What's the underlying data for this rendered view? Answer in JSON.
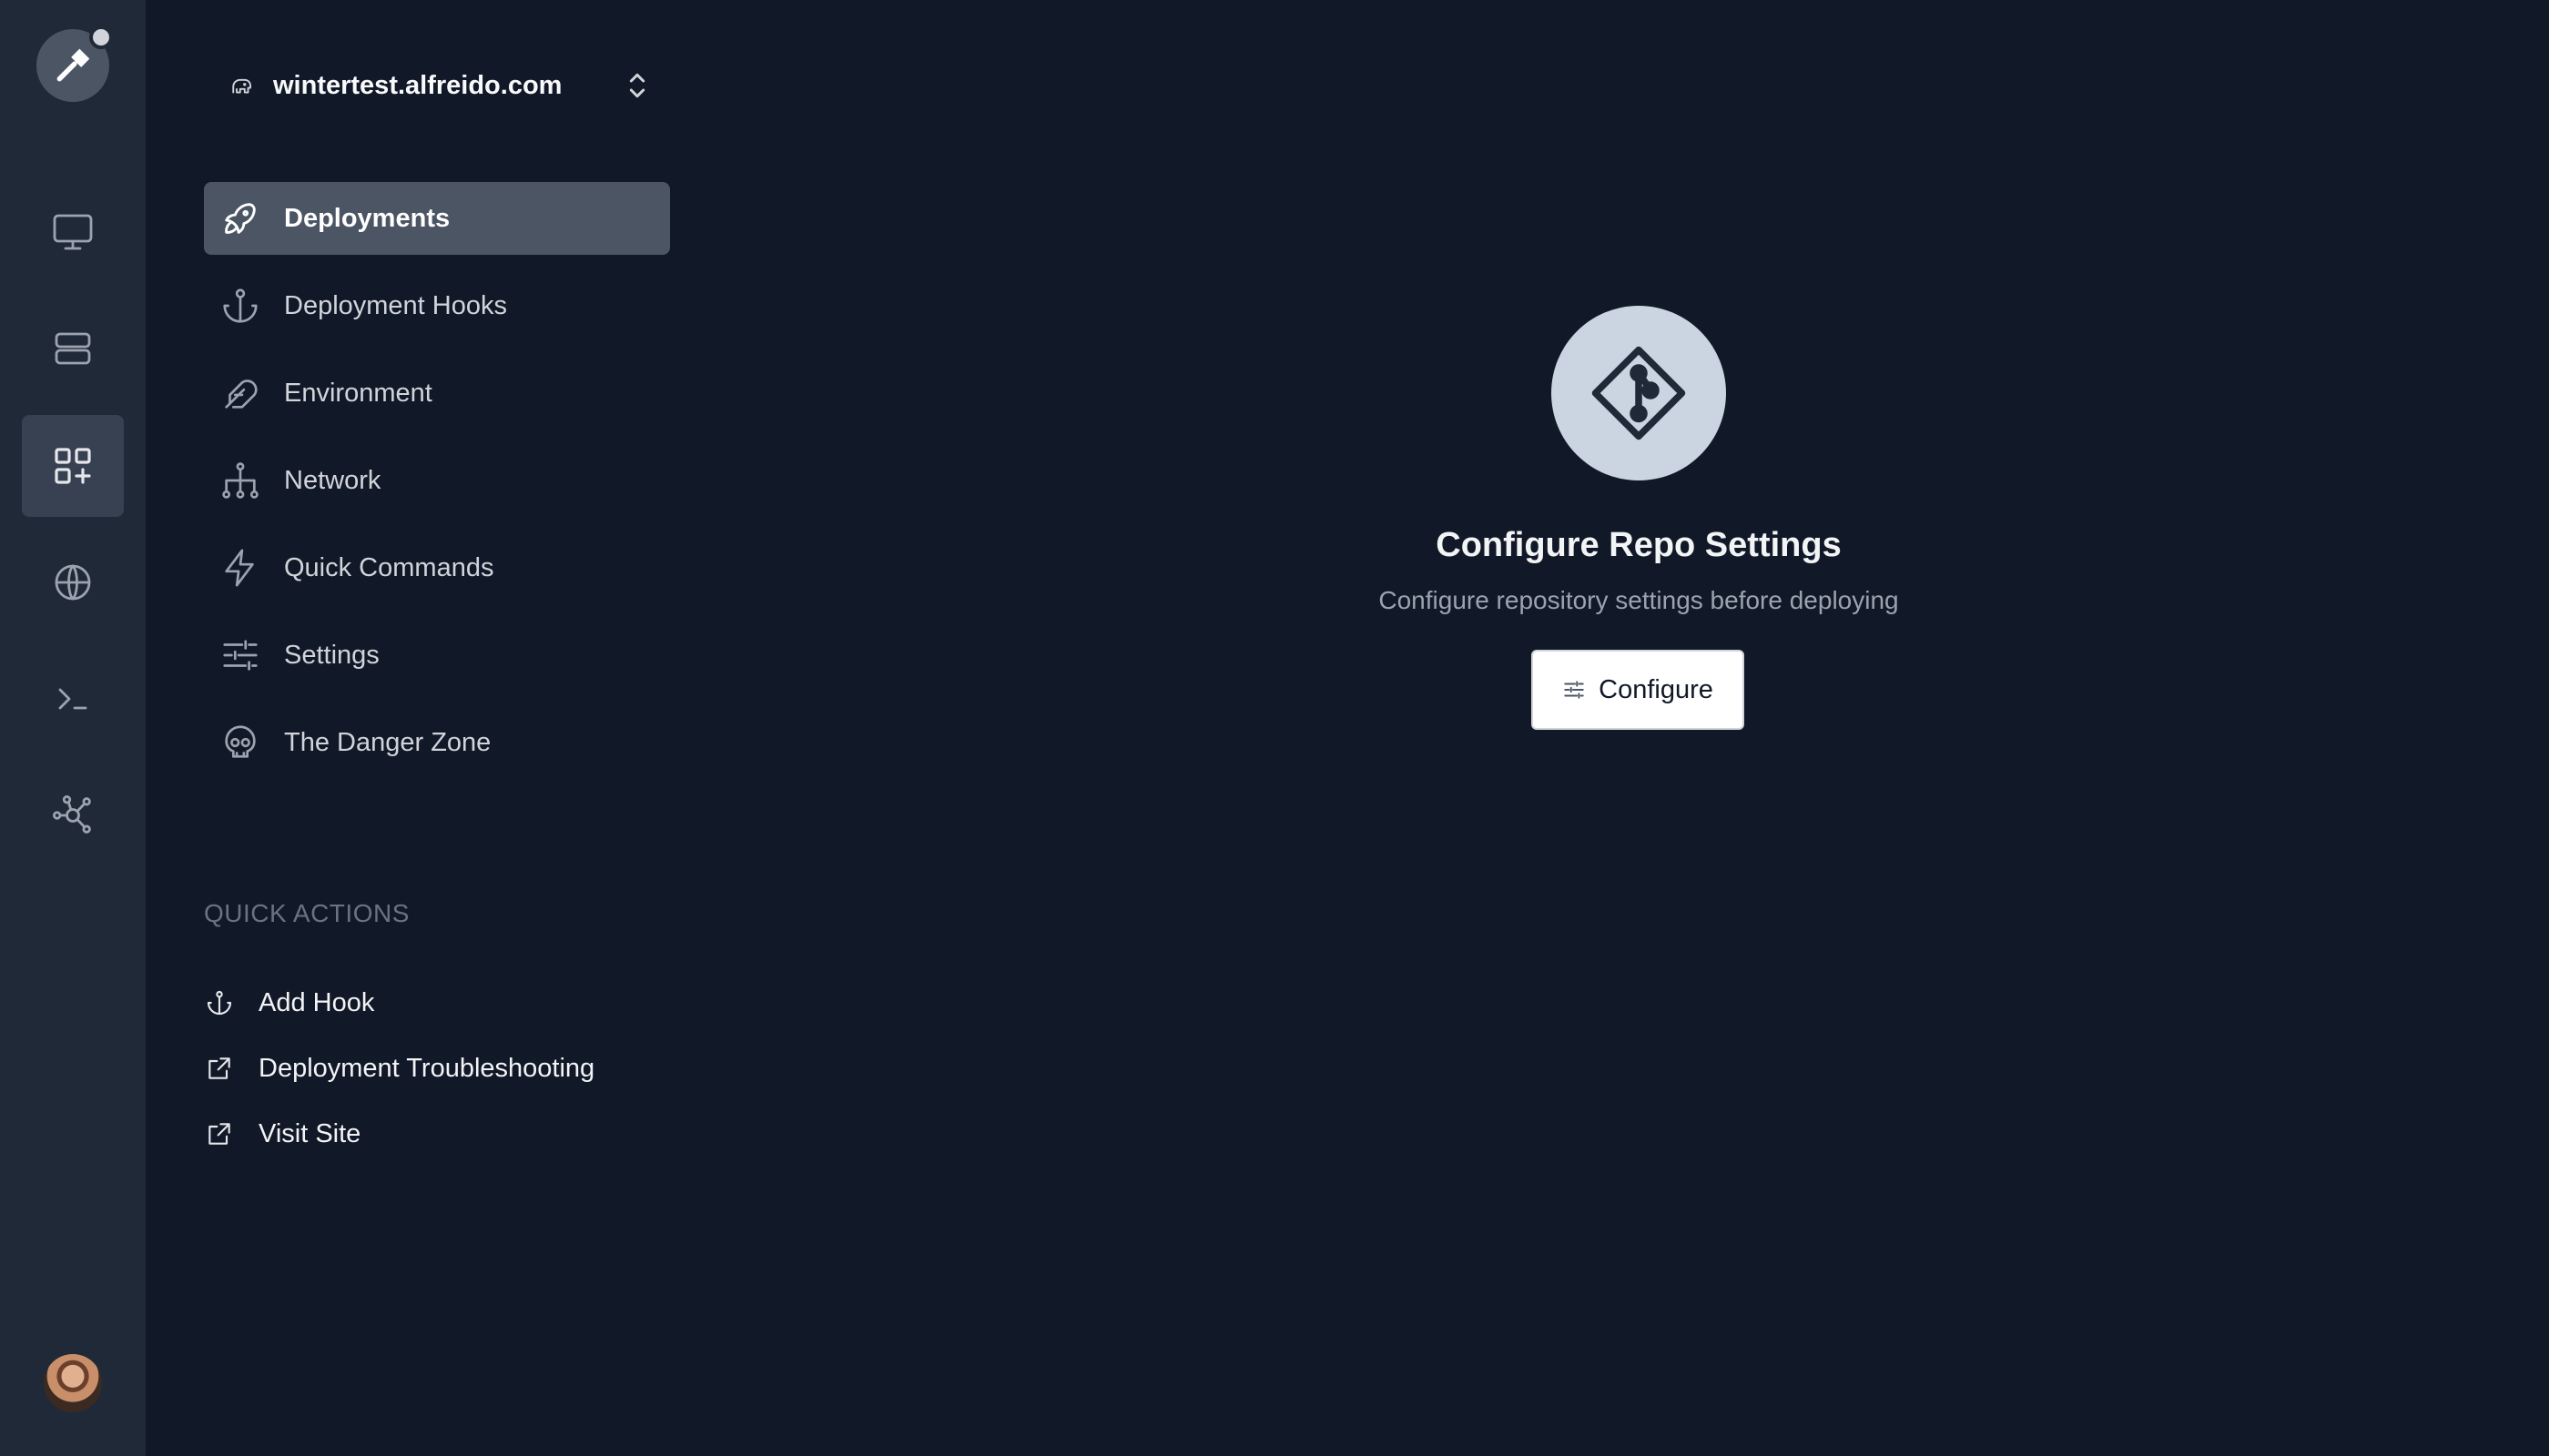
{
  "site": {
    "name": "wintertest.alfreido.com"
  },
  "nav": {
    "items": [
      {
        "label": "Deployments",
        "icon": "rocket-icon",
        "active": true
      },
      {
        "label": "Deployment Hooks",
        "icon": "anchor-icon"
      },
      {
        "label": "Environment",
        "icon": "feather-icon"
      },
      {
        "label": "Network",
        "icon": "network-icon"
      },
      {
        "label": "Quick Commands",
        "icon": "bolt-icon"
      },
      {
        "label": "Settings",
        "icon": "sliders-icon"
      },
      {
        "label": "The Danger Zone",
        "icon": "skull-icon"
      }
    ]
  },
  "quick_actions": {
    "title": "QUICK ACTIONS",
    "items": [
      {
        "label": "Add Hook",
        "icon": "anchor-icon"
      },
      {
        "label": "Deployment Troubleshooting",
        "icon": "external-link-icon"
      },
      {
        "label": "Visit Site",
        "icon": "external-link-icon"
      }
    ]
  },
  "rail": {
    "items": [
      "monitor-icon",
      "server-icon",
      "apps-add-icon",
      "globe-icon",
      "terminal-icon",
      "nodes-icon"
    ],
    "active_index": 2
  },
  "empty_state": {
    "icon": "git-icon",
    "title": "Configure Repo Settings",
    "subtitle": "Configure repository settings before deploying",
    "button_label": "Configure"
  },
  "colors": {
    "background": "#111827",
    "rail": "#1f2937",
    "active_item": "#4b5563",
    "icon_circle": "#cbd5e1"
  }
}
